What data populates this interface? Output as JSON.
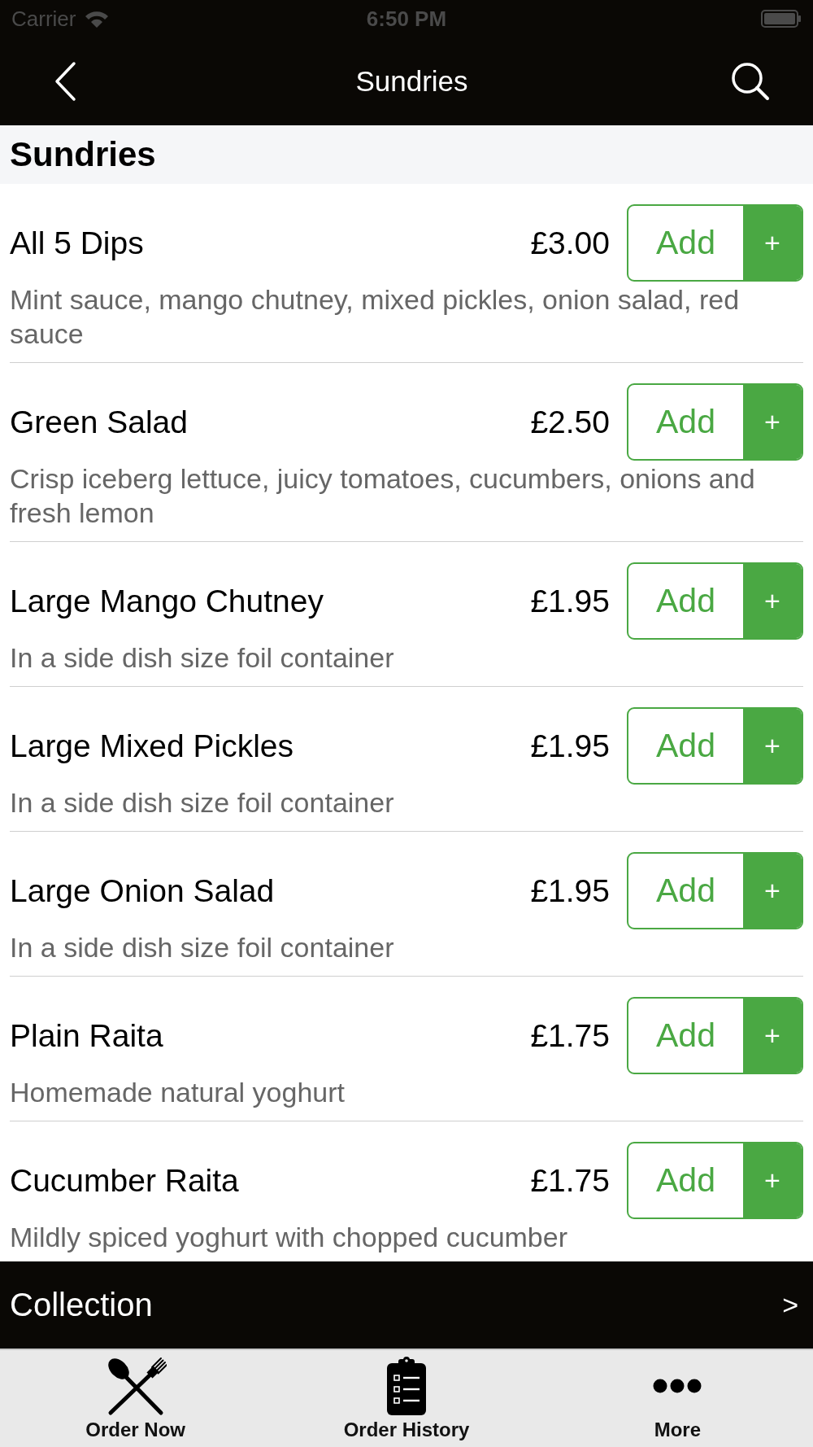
{
  "status_bar": {
    "carrier": "Carrier",
    "time": "6:50 PM"
  },
  "nav_bar": {
    "title": "Sundries"
  },
  "section": {
    "title": "Sundries"
  },
  "items": [
    {
      "name": "All 5 Dips",
      "price": "£3.00",
      "description": "Mint sauce, mango chutney, mixed pickles, onion salad, red sauce",
      "add_label": "Add",
      "add_symbol": "+"
    },
    {
      "name": "Green Salad",
      "price": "£2.50",
      "description": "Crisp iceberg lettuce, juicy tomatoes, cucumbers, onions and fresh lemon",
      "add_label": "Add",
      "add_symbol": "+"
    },
    {
      "name": "Large Mango Chutney",
      "price": "£1.95",
      "description": "In a side dish size foil container",
      "add_label": "Add",
      "add_symbol": "+"
    },
    {
      "name": "Large Mixed Pickles",
      "price": "£1.95",
      "description": "In a side dish size foil container",
      "add_label": "Add",
      "add_symbol": "+"
    },
    {
      "name": "Large Onion Salad",
      "price": "£1.95",
      "description": "In a side dish size foil container",
      "add_label": "Add",
      "add_symbol": "+"
    },
    {
      "name": "Plain Raita",
      "price": "£1.75",
      "description": "Homemade natural yoghurt",
      "add_label": "Add",
      "add_symbol": "+"
    },
    {
      "name": "Cucumber Raita",
      "price": "£1.75",
      "description": "Mildly spiced yoghurt with chopped cucumber",
      "add_label": "Add",
      "add_symbol": "+"
    }
  ],
  "order_type_bar": {
    "label": "Collection",
    "arrow": ">"
  },
  "tab_bar": [
    {
      "label": "Order Now",
      "kind": "cutlery"
    },
    {
      "label": "Order History",
      "kind": "clipboard"
    },
    {
      "label": "More",
      "kind": "more"
    }
  ]
}
